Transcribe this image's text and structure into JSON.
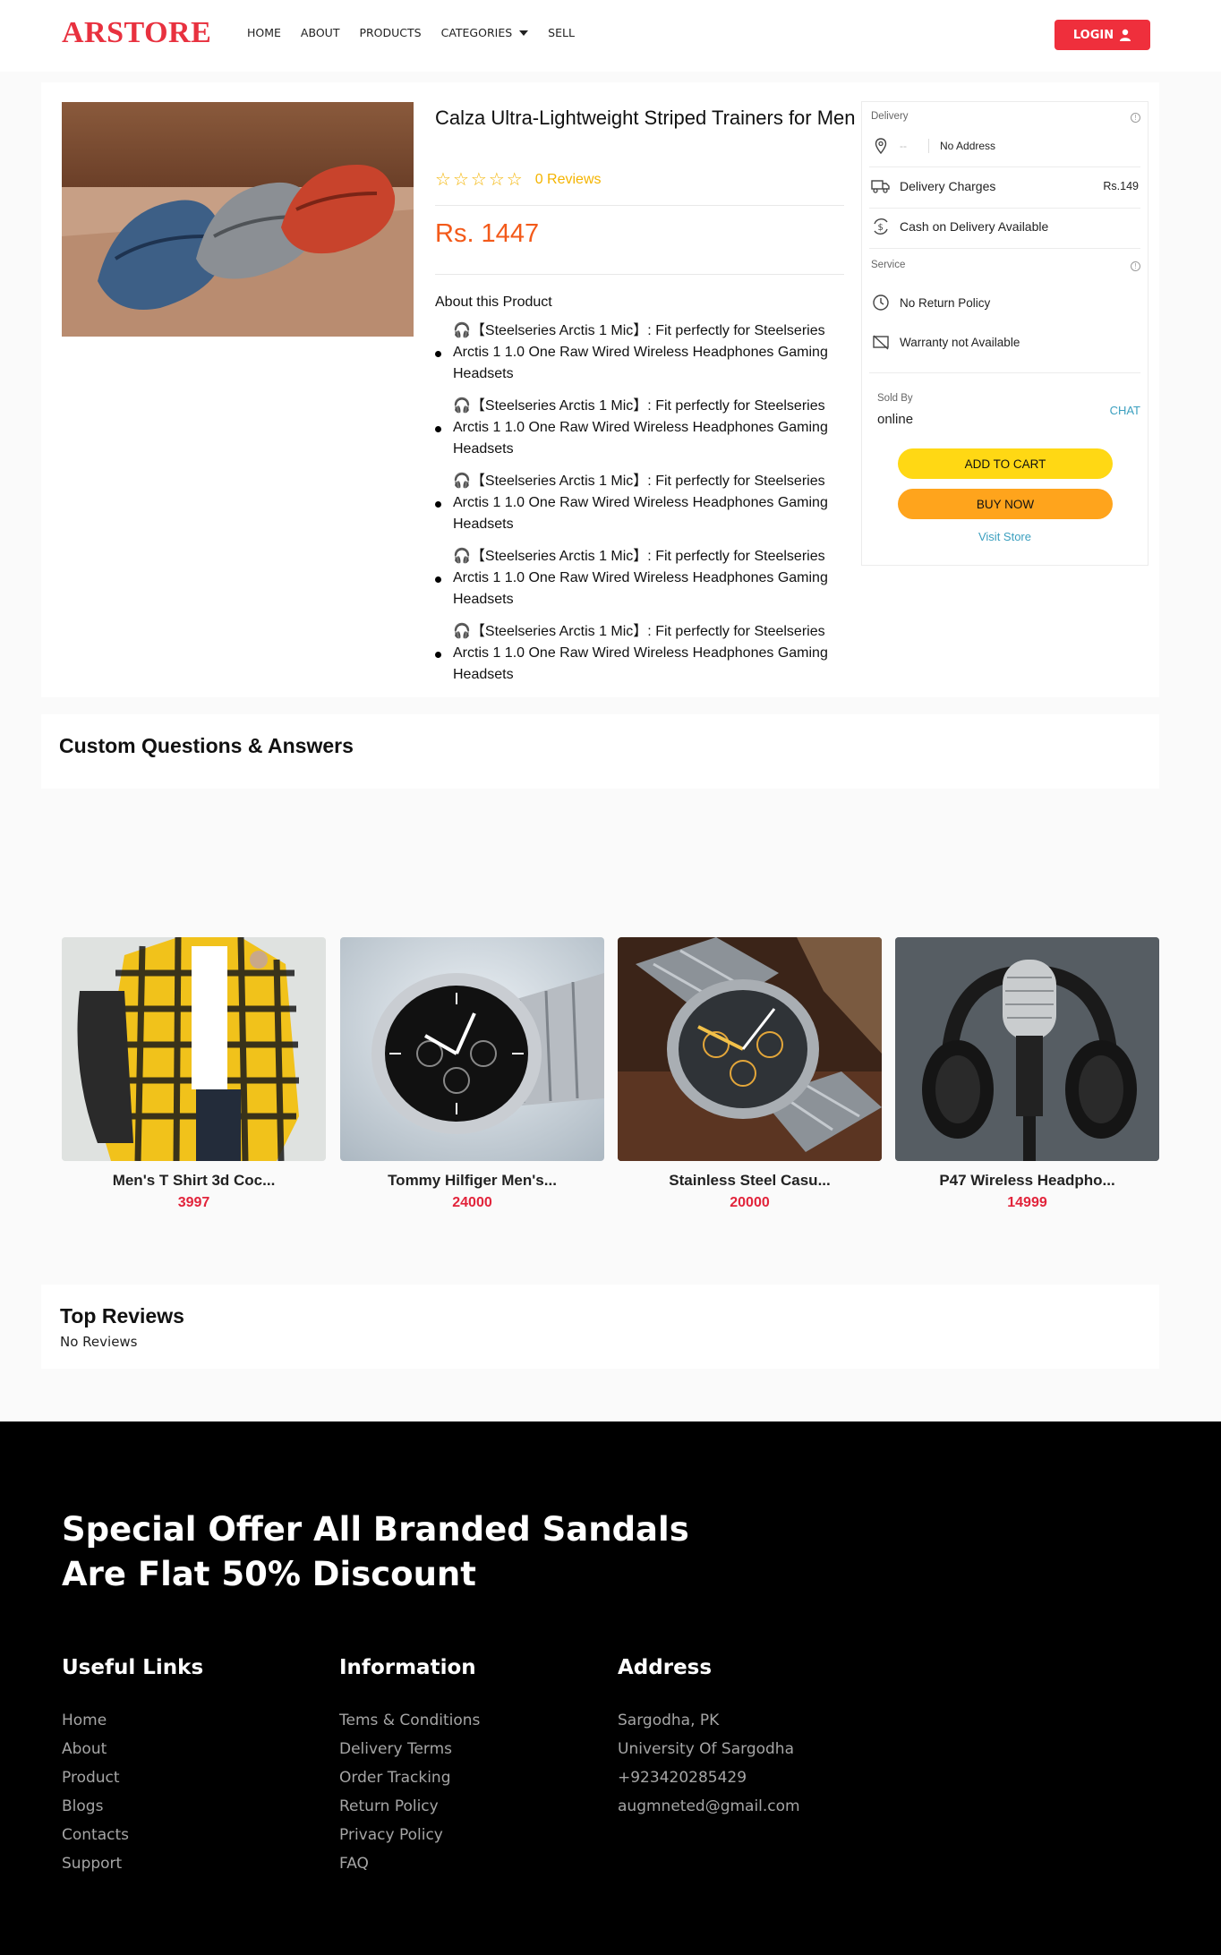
{
  "nav": {
    "logo": "ARSTORE",
    "links": [
      "HOME",
      "ABOUT",
      "PRODUCTS",
      "CATEGORIES",
      "SELL"
    ],
    "login": "LOGIN"
  },
  "product": {
    "title": "Calza Ultra-Lightweight Striped Trainers for Men",
    "rating": 0,
    "reviews_text": "0 Reviews",
    "price": "Rs. 1447",
    "about_heading": "About this Product",
    "bullets": [
      "【Steelseries Arctis 1 Mic】: Fit perfectly for Steelseries Arctis 1 1.0 One Raw Wired Wireless Headphones Gaming Headsets",
      "【Steelseries Arctis 1 Mic】: Fit perfectly for Steelseries Arctis 1 1.0 One Raw Wired Wireless Headphones Gaming Headsets",
      "【Steelseries Arctis 1 Mic】: Fit perfectly for Steelseries Arctis 1 1.0 One Raw Wired Wireless Headphones Gaming Headsets",
      "【Steelseries Arctis 1 Mic】: Fit perfectly for Steelseries Arctis 1 1.0 One Raw Wired Wireless Headphones Gaming Headsets",
      "【Steelseries Arctis 1 Mic】: Fit perfectly for Steelseries Arctis 1 1.0 One Raw Wired Wireless Headphones Gaming Headsets"
    ]
  },
  "side": {
    "delivery_label": "Delivery",
    "address_dash": "--",
    "address": "No Address",
    "delivery_charges": "Delivery Charges",
    "delivery_charges_value": "Rs.149",
    "cod": "Cash on Delivery Available",
    "service_label": "Service",
    "no_return": "No Return Policy",
    "warranty": "Warranty not Available",
    "sold_by_label": "Sold By",
    "sold_by": "online",
    "chat": "CHAT",
    "add_to_cart": "ADD TO CART",
    "buy_now": "BUY NOW",
    "visit_store": "Visit Store"
  },
  "qa": {
    "title": "Custom Questions & Answers"
  },
  "related": [
    {
      "name": "Men's T Shirt 3d Coc...",
      "price": "3997",
      "icon": "shirt-photo"
    },
    {
      "name": "Tommy Hilfiger Men's...",
      "price": "24000",
      "icon": "watch-photo"
    },
    {
      "name": "Stainless Steel Casu...",
      "price": "20000",
      "icon": "watch-photo"
    },
    {
      "name": "P47 Wireless Headpho...",
      "price": "14999",
      "icon": "headphones-photo"
    }
  ],
  "top_reviews": {
    "title": "Top Reviews",
    "empty": "No Reviews"
  },
  "footer": {
    "offer": "Special Offer All Branded Sandals Are Flat 50% Discount",
    "useful_links": {
      "title": "Useful Links",
      "items": [
        "Home",
        "About",
        "Product",
        "Blogs",
        "Contacts",
        "Support"
      ]
    },
    "information": {
      "title": "Information",
      "items": [
        "Tems & Conditions",
        "Delivery Terms",
        "Order Tracking",
        "Return Policy",
        "Privacy Policy",
        "FAQ"
      ]
    },
    "address": {
      "title": "Address",
      "items": [
        "Sargodha, PK",
        "University Of Sargodha",
        "+923420285429",
        "augmneted@gmail.com"
      ]
    }
  },
  "colors": {
    "brand": "#e8313f",
    "price": "#f35a1a",
    "star": "#f4b400",
    "cart": "#ffd814",
    "buy": "#ffa41c",
    "link": "#3a9fbf"
  }
}
